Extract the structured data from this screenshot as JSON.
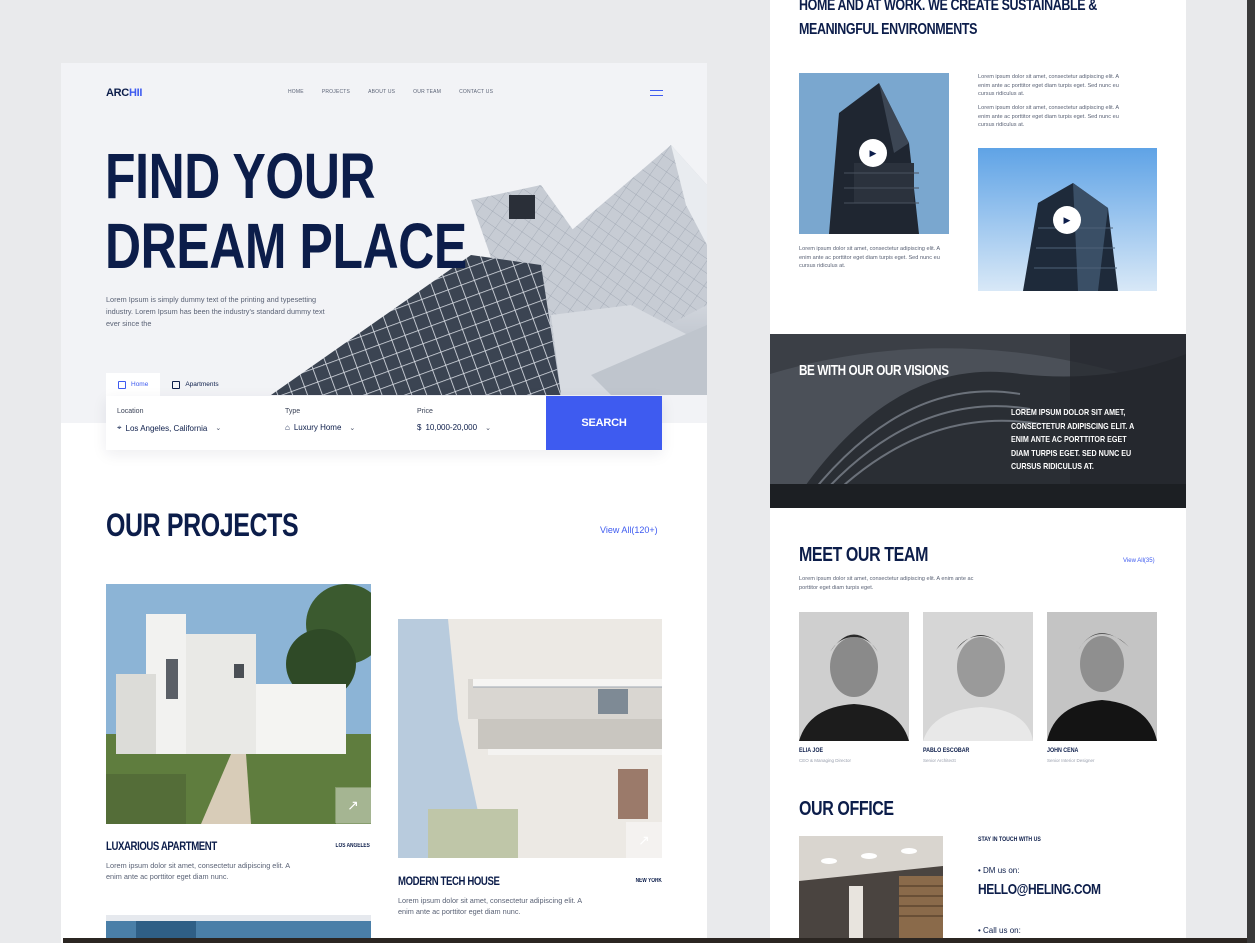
{
  "left": {
    "logo": {
      "main": "ARC",
      "accent": "HII"
    },
    "nav": [
      "HOME",
      "PROJECTS",
      "ABOUT US",
      "OUR TEAM",
      "CONTACT US"
    ],
    "hero": {
      "title_line1": "FIND YOUR",
      "title_line2": "DREAM PLACE",
      "text": "Lorem Ipsum is simply dummy text of the printing and typesetting industry. Lorem Ipsum has been the industry's standard dummy text ever since the"
    },
    "search": {
      "tabs": [
        "Home",
        "Apartments"
      ],
      "location": {
        "label": "Location",
        "value": "Los Angeles, California"
      },
      "type": {
        "label": "Type",
        "value": "Luxury Home"
      },
      "price": {
        "label": "Price",
        "value": "10,000-20,000"
      },
      "button": "SEARCH"
    },
    "projects": {
      "title": "OUR PROJECTS",
      "view_all": "View All(120+)",
      "items": [
        {
          "title": "LUXARIOUS APARTMENT",
          "city": "LOS ANGELES",
          "text": "Lorem ipsum dolor sit amet, consectetur adipiscing elit. A enim ante ac porttitor eget diam nunc."
        },
        {
          "title": "MODERN TECH HOUSE",
          "city": "NEW YORK",
          "text": "Lorem ipsum dolor sit amet, consectetur adipiscing elit. A enim ante ac porttitor eget diam nunc."
        }
      ]
    }
  },
  "right": {
    "heading_line1": "HOME AND AT WORK. WE CREATE SUSTAINABLE &",
    "heading_line2": "MEANINGFUL ENVIRONMENTS",
    "para1": "Lorem ipsum dolor sit amet, consectetur adipiscing elit. A enim ante ac porttitor eget diam turpis eget. Sed nunc eu cursus ridiculus at.",
    "para2": "Lorem ipsum dolor sit amet, consectetur adipiscing elit. A enim ante ac porttitor eget diam turpis eget. Sed nunc eu cursus ridiculus at.",
    "caption": "Lorem ipsum dolor sit amet, consectetur adipiscing elit. A enim ante ac porttitor eget diam turpis eget. Sed nunc eu cursus ridiculus at.",
    "visions": {
      "title": "BE WITH OUR OUR VISIONS",
      "text": "LOREM IPSUM DOLOR SIT AMET, CONSECTETUR ADIPISCING ELIT. A ENIM ANTE AC PORTTITOR EGET DIAM TURPIS EGET. SED NUNC EU CURSUS RIDICULUS AT."
    },
    "team": {
      "title": "MEET OUR TEAM",
      "view_all": "View All(35)",
      "text": "Lorem ipsum dolor sit amet, consectetur adipiscing elit. A enim ante ac porttitor eget diam turpis eget.",
      "members": [
        {
          "name": "ELIA JOE",
          "role": "CEO & Managing Director"
        },
        {
          "name": "PABLO ESCOBAR",
          "role": "Senior Architectt"
        },
        {
          "name": "JOHN CENA",
          "role": "Senior Interior Designer"
        }
      ]
    },
    "office": {
      "title": "OUR OFFICE",
      "stay": "STAY IN TOUCH WITH US",
      "dm_label": "• DM us on:",
      "email": "HELLO@HELING.COM",
      "call_label": "• Call us on:"
    }
  }
}
